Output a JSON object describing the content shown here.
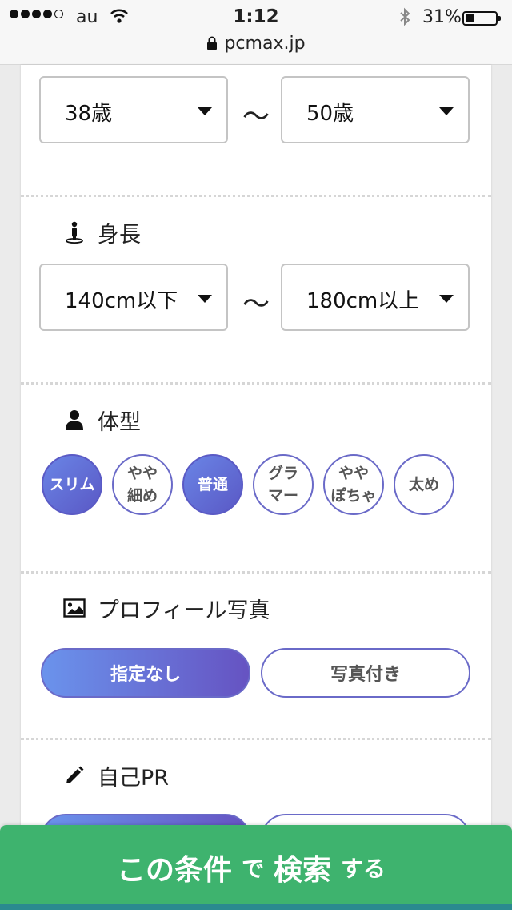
{
  "status_bar": {
    "carrier": "au",
    "time": "1:12",
    "battery_pct": "31%",
    "battery_level": 0.31,
    "url": "pcmax.jp"
  },
  "age": {
    "from": "38歳",
    "to": "50歳",
    "separator": "〜"
  },
  "height": {
    "title": "身長",
    "from": "140cm以下",
    "to": "180cm以上",
    "separator": "〜"
  },
  "body_type": {
    "title": "体型",
    "options": [
      {
        "label": "スリム",
        "selected": true
      },
      {
        "label": "やや\n細め",
        "selected": false
      },
      {
        "label": "普通",
        "selected": true
      },
      {
        "label": "グラ\nマー",
        "selected": false
      },
      {
        "label": "やや\nぽちゃ",
        "selected": false
      },
      {
        "label": "太め",
        "selected": false
      }
    ]
  },
  "photo": {
    "title": "プロフィール写真",
    "options": [
      {
        "label": "指定なし",
        "selected": true
      },
      {
        "label": "写真付き",
        "selected": false
      }
    ]
  },
  "self_pr": {
    "title": "自己PR"
  },
  "search_button": {
    "part1": "この条件",
    "part2": "で",
    "part3": "検索",
    "part4": "する"
  },
  "colors": {
    "accent": "#5a58c5",
    "search_green": "#3eb36e"
  }
}
